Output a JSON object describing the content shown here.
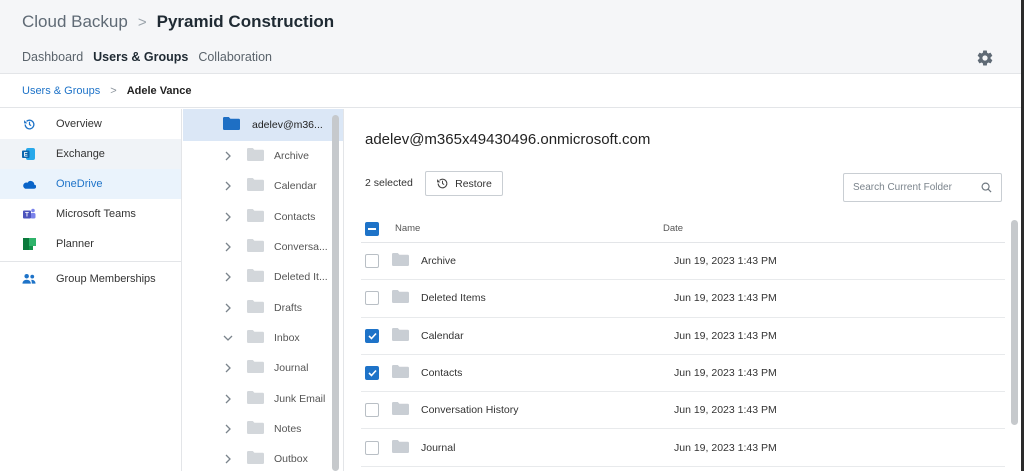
{
  "header": {
    "app": "Cloud Backup",
    "separator": ">",
    "org": "Pyramid Construction",
    "tabs": [
      {
        "label": "Dashboard",
        "active": false
      },
      {
        "label": "Users & Groups",
        "active": true
      },
      {
        "label": "Collaboration",
        "active": false
      }
    ],
    "settings_icon": "gear-icon"
  },
  "breadcrumb": {
    "parent": "Users & Groups",
    "separator": ">",
    "current": "Adele Vance"
  },
  "leftnav": {
    "items": [
      {
        "label": "Overview",
        "icon": "history-icon"
      },
      {
        "label": "Exchange",
        "icon": "exchange-icon",
        "selected": true
      },
      {
        "label": "OneDrive",
        "icon": "onedrive-icon",
        "hover": true
      },
      {
        "label": "Microsoft Teams",
        "icon": "teams-icon"
      },
      {
        "label": "Planner",
        "icon": "planner-icon"
      },
      {
        "label": "Group Memberships",
        "icon": "people-icon"
      }
    ]
  },
  "tree": {
    "root": "adelev@m36...",
    "items": [
      {
        "label": "Archive",
        "expanded": false
      },
      {
        "label": "Calendar",
        "expanded": false
      },
      {
        "label": "Contacts",
        "expanded": false
      },
      {
        "label": "Conversa...",
        "expanded": false
      },
      {
        "label": "Deleted It...",
        "expanded": false
      },
      {
        "label": "Drafts",
        "expanded": false
      },
      {
        "label": "Inbox",
        "expanded": true
      },
      {
        "label": "Journal",
        "expanded": false
      },
      {
        "label": "Junk Email",
        "expanded": false
      },
      {
        "label": "Notes",
        "expanded": false
      },
      {
        "label": "Outbox",
        "expanded": false
      }
    ]
  },
  "main": {
    "title": "adelev@m365x49430496.onmicrosoft.com",
    "selected_count": "2 selected",
    "restore_label": "Restore",
    "search_placeholder": "Search Current Folder",
    "columns": {
      "name": "Name",
      "date": "Date"
    },
    "rows": [
      {
        "name": "Archive",
        "date": "Jun 19, 2023 1:43 PM",
        "checked": false
      },
      {
        "name": "Deleted Items",
        "date": "Jun 19, 2023 1:43 PM",
        "checked": false
      },
      {
        "name": "Calendar",
        "date": "Jun 19, 2023 1:43 PM",
        "checked": true
      },
      {
        "name": "Contacts",
        "date": "Jun 19, 2023 1:43 PM",
        "checked": true
      },
      {
        "name": "Conversation History",
        "date": "Jun 19, 2023 1:43 PM",
        "checked": false
      },
      {
        "name": "Journal",
        "date": "Jun 19, 2023 1:43 PM",
        "checked": false
      }
    ]
  },
  "colors": {
    "accent": "#1e73c8",
    "folder": "#c9ced4",
    "folder_root": "#1e6fc4"
  }
}
